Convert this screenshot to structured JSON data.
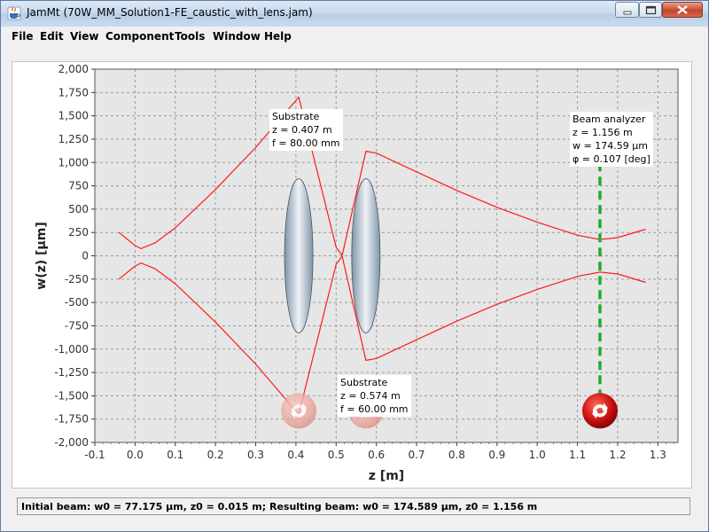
{
  "window": {
    "title": "JamMt (70W_MM_Solution1-FE_caustic_with_lens.jam)"
  },
  "menu": [
    "File",
    "Edit",
    "View",
    "Component",
    "Tools",
    "Window",
    "Help"
  ],
  "annotations": {
    "substrate1": [
      "Substrate",
      "z = 0.407 m",
      "f = 80.00 mm"
    ],
    "substrate2": [
      "Substrate",
      "z = 0.574 m",
      "f = 60.00 mm"
    ],
    "analyzer": [
      "Beam analyzer",
      "z = 1.156 m",
      "w = 174.59 µm",
      "φ = 0.107 [deg]"
    ]
  },
  "status": {
    "text": "Initial beam: w0 = 77.175 µm, z0 = 0.015 m; Resulting beam: w0 = 174.589 µm, z0 = 1.156 m"
  },
  "colors": {
    "beam": "#ff1a1a",
    "analyzer_line": "#22aa33",
    "plot_bg": "#e6e6e6",
    "grid": "#9a9a9a"
  },
  "chart_data": {
    "type": "line",
    "title": "",
    "xlabel": "z [m]",
    "ylabel": "w(z) [µm]",
    "xlim": [
      -0.1,
      1.35
    ],
    "ylim": [
      -2000,
      2000
    ],
    "xticks": [
      "-0.1",
      "0.0",
      "0.1",
      "0.2",
      "0.3",
      "0.4",
      "0.5",
      "0.6",
      "0.7",
      "0.8",
      "0.9",
      "1.0",
      "1.1",
      "1.2",
      "1.3"
    ],
    "xtick_values": [
      -0.1,
      0.0,
      0.1,
      0.2,
      0.3,
      0.4,
      0.5,
      0.6,
      0.7,
      0.8,
      0.9,
      1.0,
      1.1,
      1.2,
      1.3
    ],
    "yticks": [
      "2,000",
      "1,750",
      "1,500",
      "1,250",
      "1,000",
      "750",
      "500",
      "250",
      "0",
      "-250",
      "-500",
      "-750",
      "-1,000",
      "-1,250",
      "-1,500",
      "-1,750",
      "-2,000"
    ],
    "ytick_values": [
      2000,
      1750,
      1500,
      1250,
      1000,
      750,
      500,
      250,
      0,
      -250,
      -500,
      -750,
      -1000,
      -1250,
      -1500,
      -1750,
      -2000
    ],
    "grid": true,
    "beam_upper": [
      [
        -0.04,
        250
      ],
      [
        0.0,
        110
      ],
      [
        0.015,
        77
      ],
      [
        0.05,
        140
      ],
      [
        0.1,
        300
      ],
      [
        0.2,
        710
      ],
      [
        0.3,
        1160
      ],
      [
        0.407,
        1700
      ],
      [
        0.5,
        90
      ],
      [
        0.515,
        5
      ],
      [
        0.574,
        1120
      ],
      [
        0.6,
        1100
      ],
      [
        0.7,
        900
      ],
      [
        0.8,
        700
      ],
      [
        0.9,
        520
      ],
      [
        1.0,
        360
      ],
      [
        1.1,
        220
      ],
      [
        1.156,
        175
      ],
      [
        1.2,
        195
      ],
      [
        1.27,
        285
      ]
    ],
    "beam_lower": [
      [
        -0.04,
        -250
      ],
      [
        0.0,
        -110
      ],
      [
        0.015,
        -77
      ],
      [
        0.05,
        -140
      ],
      [
        0.1,
        -300
      ],
      [
        0.2,
        -710
      ],
      [
        0.3,
        -1160
      ],
      [
        0.407,
        -1700
      ],
      [
        0.5,
        -90
      ],
      [
        0.515,
        -5
      ],
      [
        0.574,
        -1120
      ],
      [
        0.6,
        -1100
      ],
      [
        0.7,
        -900
      ],
      [
        0.8,
        -700
      ],
      [
        0.9,
        -520
      ],
      [
        1.0,
        -360
      ],
      [
        1.1,
        -220
      ],
      [
        1.156,
        -175
      ],
      [
        1.2,
        -195
      ],
      [
        1.27,
        -285
      ]
    ],
    "components": [
      {
        "name": "Substrate",
        "z": 0.407,
        "f": 80.0
      },
      {
        "name": "Substrate",
        "z": 0.574,
        "f": 60.0
      },
      {
        "name": "Beam analyzer",
        "z": 1.156
      }
    ]
  }
}
